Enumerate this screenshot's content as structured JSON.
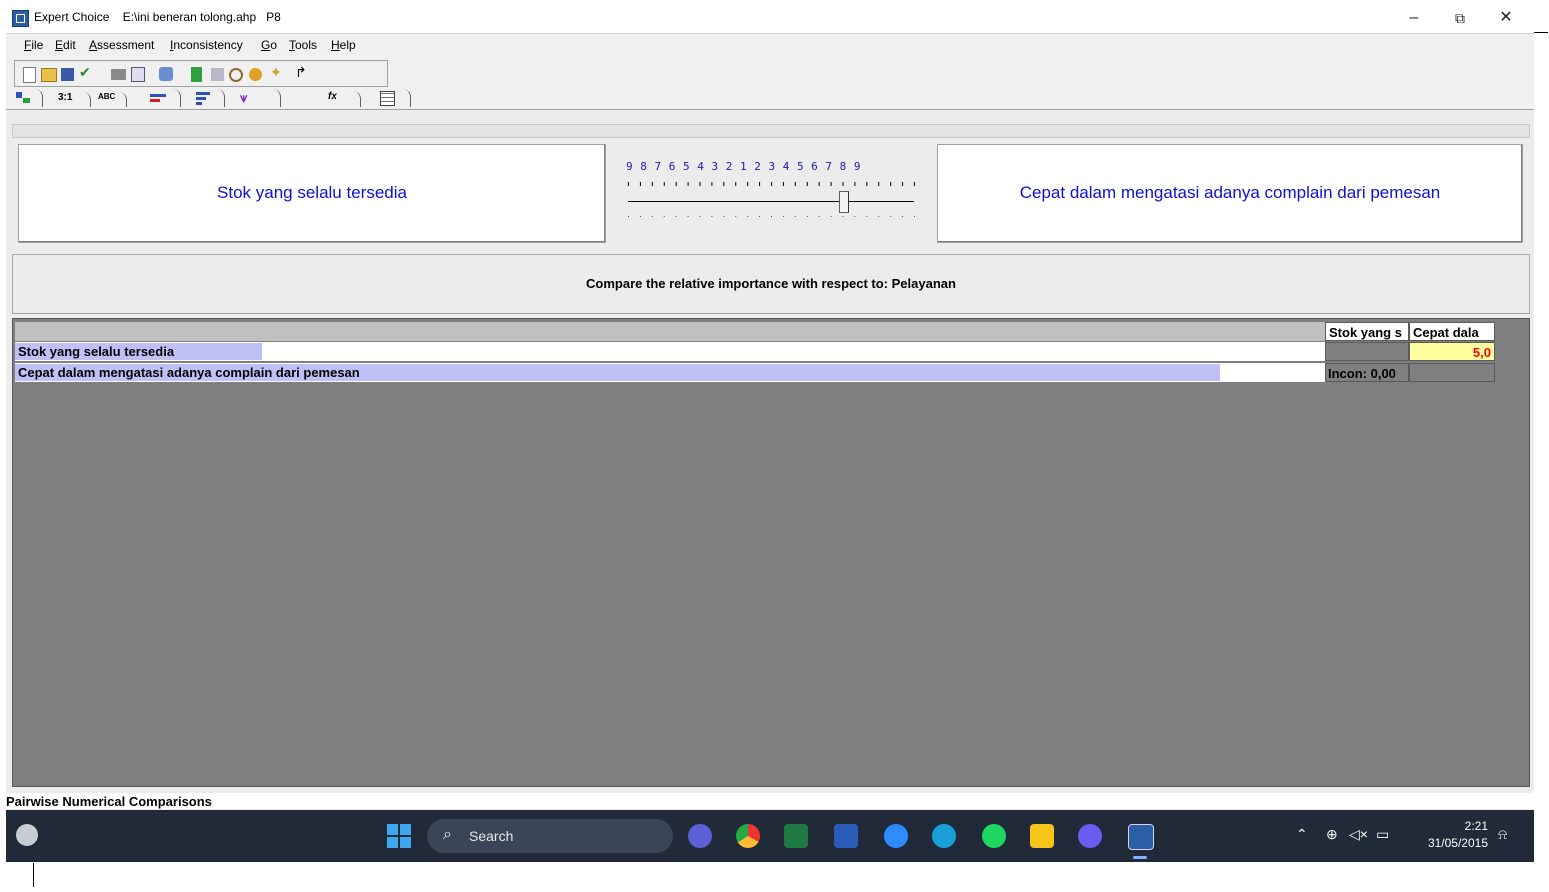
{
  "window": {
    "app_name": "Expert Choice",
    "file_path": "E:\\ini beneran tolong.ahp",
    "node": "P8",
    "minimize": "–",
    "maximize": "⧉",
    "close": "✕"
  },
  "menu": [
    {
      "underline": "F",
      "rest": "ile"
    },
    {
      "underline": "E",
      "rest": "dit"
    },
    {
      "underline": "A",
      "rest": "ssessment"
    },
    {
      "underline": "I",
      "rest": "nconsistency"
    },
    {
      "underline": "G",
      "rest": "o"
    },
    {
      "underline": "T",
      "rest": "ools"
    },
    {
      "underline": "H",
      "rest": "elp"
    }
  ],
  "tabs": {
    "numerical": "3:1",
    "verbal": "ABC",
    "formula": "fx"
  },
  "comparison": {
    "left_element": "Stok yang selalu tersedia",
    "right_element": "Cepat dalam mengatasi adanya complain dari pemesan",
    "scale_label": "9 8 7 6 5 4 3 2 1 2 3 4 5 6 7 8 9",
    "slider_value": 5,
    "slider_side": "right"
  },
  "with_respect_to": "Compare the relative importance with respect to: Pelayanan",
  "matrix": {
    "col_headers": [
      "Stok yang s",
      "Cepat dala"
    ],
    "rows": [
      {
        "label": "Stok yang selalu tersedia",
        "bar_fraction": 0.17
      },
      {
        "label": "Cepat dalam mengatasi adanya complain dari pemesan",
        "bar_fraction": 0.83
      }
    ],
    "value": "5,0",
    "inconsistency": "Incon: 0,00"
  },
  "status": "Pairwise Numerical Comparisons",
  "taskbar": {
    "search_placeholder": "Search",
    "time": "2:21",
    "date": "31/05/2015",
    "tray_icons": [
      "chevron-up-icon",
      "globe-icon",
      "speaker-muted-icon",
      "battery-icon",
      "notification-icon"
    ]
  },
  "colors": {
    "element_text": "#1010d0",
    "bar_fill": "#c0c0f8",
    "value_bg": "#ffffa0",
    "value_text": "#ff0000",
    "grid_bg": "#7f7f7f"
  }
}
